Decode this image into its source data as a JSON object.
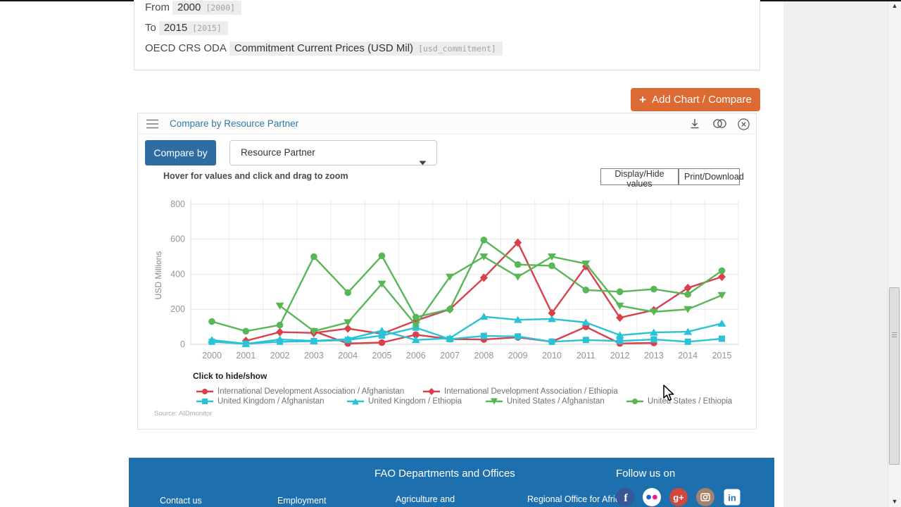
{
  "filters": {
    "from_label": "From",
    "from_value": "2000",
    "from_code": "[2000]",
    "to_label": "To",
    "to_value": "2015",
    "to_code": "[2015]",
    "indicator_label": "OECD CRS ODA",
    "indicator_value": "Commitment Current Prices (USD Mil)",
    "indicator_code": "[usd_commitment]"
  },
  "toolbar": {
    "add_chart_label": "Add Chart / Compare",
    "add_chart_plus": "+",
    "add_chart_color": "#dc6a32"
  },
  "panel": {
    "title": "Compare by Resource Partner",
    "title_color": "#3279a9",
    "compare_by_label": "Compare by",
    "compare_by_color": "#2e6da4",
    "dropdown_value": "Resource Partner",
    "hint": "Hover for values and click and drag to zoom",
    "display_hide_label": "Display/Hide values",
    "print_download_label": "Print/Download",
    "legend_title": "Click to hide/show",
    "source": "Source: AIDmonitor",
    "icons": [
      "menu-icon",
      "download-icon",
      "compare-icon",
      "close-circle-icon"
    ]
  },
  "chart_data": {
    "type": "line",
    "title": "Compare by Resource Partner",
    "xlabel": "",
    "ylabel": "USD Millions",
    "x": [
      2000,
      2001,
      2002,
      2003,
      2004,
      2005,
      2006,
      2007,
      2008,
      2009,
      2010,
      2011,
      2012,
      2013,
      2014,
      2015
    ],
    "y_ticks": [
      0,
      200,
      400,
      600,
      800
    ],
    "ylim": [
      0,
      800
    ],
    "grid": true,
    "legend_position": "bottom",
    "series": [
      {
        "name": "International Development Association / Afghanistan",
        "color": "#d8404c",
        "marker": "circle",
        "values": [
          null,
          null,
          null,
          75,
          5,
          10,
          55,
          30,
          28,
          40,
          15,
          100,
          5,
          8,
          null,
          null
        ]
      },
      {
        "name": "International Development Association / Ethiopia",
        "color": "#d8404c",
        "marker": "diamond",
        "values": [
          null,
          20,
          70,
          65,
          90,
          60,
          135,
          200,
          380,
          580,
          178,
          445,
          152,
          195,
          322,
          385
        ]
      },
      {
        "name": "United Kingdom / Afghanistan",
        "color": "#2bc2d6",
        "marker": "square",
        "values": [
          15,
          3,
          15,
          18,
          25,
          50,
          95,
          30,
          48,
          45,
          15,
          25,
          19,
          28,
          15,
          32
        ]
      },
      {
        "name": "United Kingdom / Ethiopia",
        "color": "#2bc2d6",
        "marker": "triangle-up",
        "values": [
          25,
          3,
          28,
          20,
          30,
          78,
          25,
          35,
          158,
          140,
          145,
          125,
          52,
          68,
          72,
          119
        ]
      },
      {
        "name": "United States / Afghanistan",
        "color": "#57b757",
        "marker": "triangle-down",
        "values": [
          null,
          null,
          220,
          75,
          125,
          345,
          110,
          385,
          500,
          385,
          500,
          460,
          220,
          185,
          200,
          280
        ]
      },
      {
        "name": "United States / Ethiopia",
        "color": "#57b757",
        "marker": "circle",
        "values": [
          130,
          75,
          110,
          500,
          295,
          505,
          155,
          200,
          595,
          455,
          448,
          310,
          300,
          315,
          285,
          420
        ]
      }
    ]
  },
  "footer": {
    "background_color": "#1d70ad",
    "departments_title": "FAO Departments and Offices",
    "follow_title": "Follow us on",
    "links": [
      "Contact us",
      "Employment",
      "Agriculture and",
      "Regional Office for Africa"
    ],
    "social": [
      "facebook",
      "flickr",
      "google-plus",
      "instagram",
      "linkedin"
    ]
  }
}
